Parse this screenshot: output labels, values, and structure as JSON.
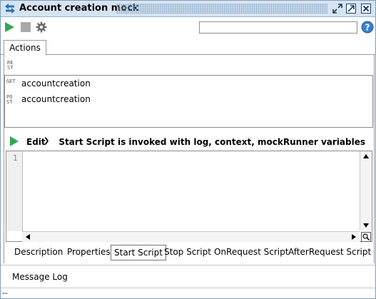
{
  "window": {
    "title": "Account creation mock"
  },
  "toolbar": {
    "icons": [
      "run-icon",
      "stop-icon",
      "settings-icon"
    ],
    "search_value": "",
    "help_icon": "help-icon"
  },
  "tabs": {
    "actions_label": "Actions"
  },
  "rest_icon_text": "RE\nST",
  "actions": [
    {
      "method_icon": "GET",
      "name": "accountcreation"
    },
    {
      "method_icon": "PO\nST",
      "name": "accountcreation"
    }
  ],
  "script": {
    "edit_label": "Edit",
    "info": "Start Script is invoked with log, context, mockRunner variables",
    "line_numbers": [
      "1"
    ],
    "content": ""
  },
  "bottom_tabs": [
    {
      "label": "Description",
      "active": false
    },
    {
      "label": "Properties",
      "active": false
    },
    {
      "label": "Start Script",
      "active": true
    },
    {
      "label": "Stop Script",
      "active": false
    },
    {
      "label": "OnRequest Script",
      "active": false
    },
    {
      "label": "AfterRequest Script",
      "active": false
    }
  ],
  "message_log_label": "Message Log",
  "status_text": "--",
  "colors": {
    "title_bar": "#d6e4f2",
    "run_green": "#2fa84f",
    "border": "#8c8c8c"
  }
}
